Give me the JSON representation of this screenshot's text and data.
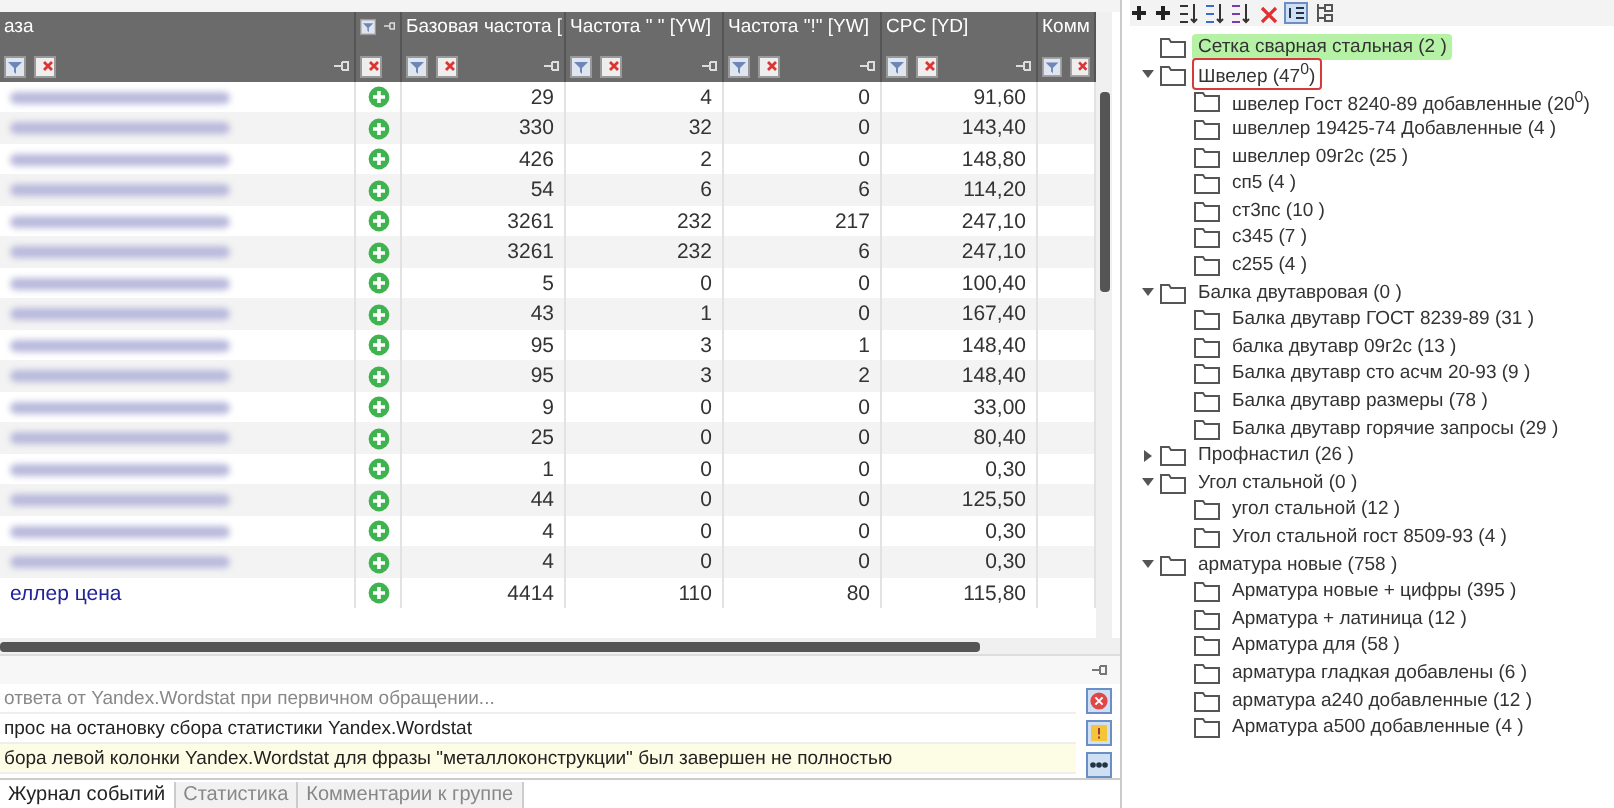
{
  "table": {
    "columns": [
      {
        "label": "аза",
        "kind": "text"
      },
      {
        "kind": "icon"
      },
      {
        "label": "Базовая частота [",
        "kind": "num"
      },
      {
        "label": "Частота \" \" [YW]",
        "kind": "num"
      },
      {
        "label": "Частота \"!\" [YW]",
        "kind": "num"
      },
      {
        "label": "CPC [YD]",
        "kind": "num"
      },
      {
        "label": "Комм",
        "kind": "text"
      }
    ],
    "rows": [
      {
        "cells": [
          "",
          "",
          "29",
          "4",
          "0",
          "91,60"
        ]
      },
      {
        "cells": [
          "",
          "",
          "330",
          "32",
          "0",
          "143,40"
        ]
      },
      {
        "cells": [
          "",
          "",
          "426",
          "2",
          "0",
          "148,80"
        ]
      },
      {
        "cells": [
          "",
          "",
          "54",
          "6",
          "6",
          "114,20"
        ]
      },
      {
        "cells": [
          "",
          "",
          "3261",
          "232",
          "217",
          "247,10"
        ]
      },
      {
        "cells": [
          "",
          "",
          "3261",
          "232",
          "6",
          "247,10"
        ]
      },
      {
        "cells": [
          "",
          "",
          "5",
          "0",
          "0",
          "100,40"
        ]
      },
      {
        "cells": [
          "",
          "",
          "43",
          "1",
          "0",
          "167,40"
        ]
      },
      {
        "cells": [
          "",
          "",
          "95",
          "3",
          "1",
          "148,40"
        ]
      },
      {
        "cells": [
          "",
          "",
          "95",
          "3",
          "2",
          "148,40"
        ]
      },
      {
        "cells": [
          "",
          "",
          "9",
          "0",
          "0",
          "33,00"
        ]
      },
      {
        "cells": [
          "",
          "",
          "25",
          "0",
          "0",
          "80,40"
        ]
      },
      {
        "cells": [
          "",
          "",
          "1",
          "0",
          "0",
          "0,30"
        ]
      },
      {
        "cells": [
          "",
          "",
          "44",
          "0",
          "0",
          "125,50"
        ]
      },
      {
        "cells": [
          "",
          "",
          "4",
          "0",
          "0",
          "0,30"
        ]
      },
      {
        "cells": [
          "",
          "",
          "4",
          "0",
          "0",
          "0,30"
        ]
      },
      {
        "cells": [
          "еллер цена",
          "",
          "4414",
          "110",
          "80",
          "115,80"
        ]
      }
    ]
  },
  "log": {
    "lines": [
      {
        "text": "ответа от Yandex.Wordstat при первичном обращении...",
        "kind": "muted"
      },
      {
        "text": "прос на остановку сбора статистики Yandex.Wordstat",
        "kind": "normal"
      },
      {
        "text": "бора левой колонки Yandex.Wordstat для фразы \"металлоконструкции\" был завершен не полностью",
        "kind": "warning"
      }
    ]
  },
  "bottom_tabs": [
    {
      "label": "Журнал событий",
      "selected": true
    },
    {
      "label": "Статистика",
      "selected": false
    },
    {
      "label": "Комментарии к группе",
      "selected": false
    }
  ],
  "tree": [
    {
      "label": "Сетка сварная стальная (2 )",
      "selected": true,
      "outlined": false
    },
    {
      "label": "Швелер (47$^{0}$)",
      "selected": false,
      "outlined": true,
      "expanded": true,
      "children": [
        {
          "label": "швелер Гост 8240-89 добавленные (20$^{0}$)"
        },
        {
          "label": "швеллер 19425-74 Добавленные (4 )"
        },
        {
          "label": "швеллер 09г2с (25 )"
        },
        {
          "label": "сп5 (4 )"
        },
        {
          "label": "ст3пс (10 )"
        },
        {
          "label": "с345 (7 )"
        },
        {
          "label": "с255 (4 )"
        }
      ]
    },
    {
      "label": "Балка двутавровая (0 )",
      "selected": false,
      "outlined": false,
      "expanded": true,
      "children": [
        {
          "label": "Балка двутавр ГОСТ 8239-89 (31 )"
        },
        {
          "label": "балка двутавр 09г2с (13 )"
        },
        {
          "label": "Балка двутавр сто асчм 20-93 (9 )"
        },
        {
          "label": "Балка двутавр размеры (78 )"
        },
        {
          "label": "Балка двутавр горячие запросы (29 )"
        }
      ]
    },
    {
      "label": "Профнастил (26 )",
      "selected": false,
      "outlined": false,
      "expanded": false
    },
    {
      "label": "Угол стальной (0 )",
      "selected": false,
      "outlined": false,
      "expanded": true,
      "children": [
        {
          "label": "угол стальной (12 )"
        },
        {
          "label": "Угол стальной гост 8509-93 (4 )"
        }
      ]
    },
    {
      "label": "арматура новые (758 )",
      "selected": false,
      "outlined": false,
      "expanded": true,
      "children": [
        {
          "label": "Арматура новые + цифры (395 )"
        },
        {
          "label": "Арматура + латиница (12 )"
        },
        {
          "label": "Арматура для (58 )"
        },
        {
          "label": "арматура гладкая добавлены (6 )"
        },
        {
          "label": "арматура а240 добавленные (12 )"
        },
        {
          "label": "Арматура а500 добавленные (4 )"
        }
      ]
    }
  ]
}
